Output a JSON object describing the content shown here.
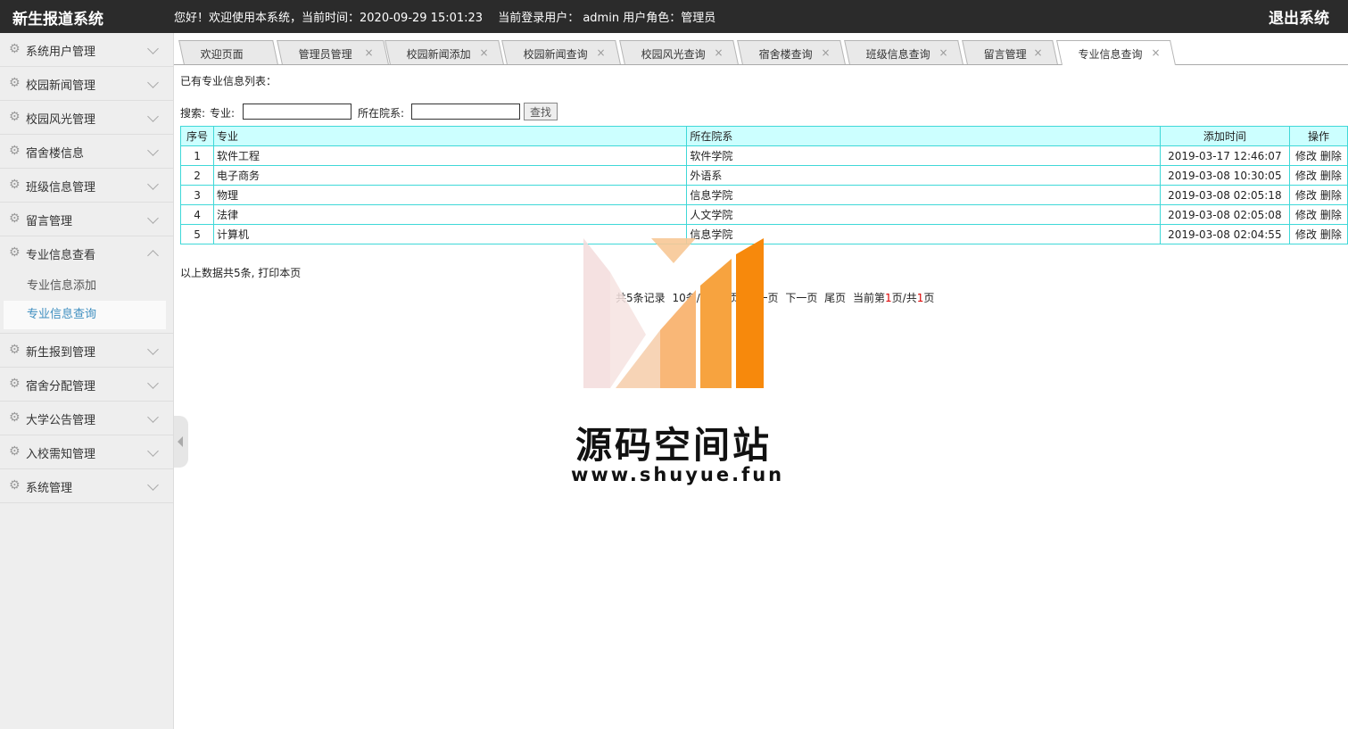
{
  "header": {
    "app_title": "新生报道系统",
    "greeting": "您好！欢迎使用本系统，当前时间：2020-09-29 15:01:23　 当前登录用户： admin  用户角色：管理员",
    "logout_label": "退出系统"
  },
  "sidebar": {
    "items": [
      {
        "label": "系统用户管理"
      },
      {
        "label": "校园新闻管理"
      },
      {
        "label": "校园风光管理"
      },
      {
        "label": "宿舍楼信息"
      },
      {
        "label": "班级信息管理"
      },
      {
        "label": "留言管理"
      },
      {
        "label": "专业信息查看"
      },
      {
        "label": "新生报到管理"
      },
      {
        "label": "宿舍分配管理"
      },
      {
        "label": "大学公告管理"
      },
      {
        "label": "入校需知管理"
      },
      {
        "label": "系统管理"
      }
    ],
    "sub_items": [
      {
        "label": "专业信息添加"
      },
      {
        "label": "专业信息查询"
      }
    ]
  },
  "tabs": [
    {
      "label": "欢迎页面"
    },
    {
      "label": "管理员管理"
    },
    {
      "label": "校园新闻添加"
    },
    {
      "label": "校园新闻查询"
    },
    {
      "label": "校园风光查询"
    },
    {
      "label": "宿舍楼查询"
    },
    {
      "label": "班级信息查询"
    },
    {
      "label": "留言管理"
    },
    {
      "label": "专业信息查询"
    }
  ],
  "tab_close_glyph": "×",
  "main": {
    "caption": "已有专业信息列表：",
    "search": {
      "prefix": "搜索:",
      "major_label": "专业:",
      "major_value": "",
      "dept_label": "所在院系:",
      "dept_value": "",
      "button": "查找"
    },
    "table": {
      "headers": [
        "序号",
        "专业",
        "所在院系",
        "添加时间",
        "操作"
      ],
      "rows": [
        {
          "idx": "1",
          "major": "软件工程",
          "dept": "软件学院",
          "time": "2019-03-17 12:46:07"
        },
        {
          "idx": "2",
          "major": "电子商务",
          "dept": "外语系",
          "time": "2019-03-08 10:30:05"
        },
        {
          "idx": "3",
          "major": "物理",
          "dept": "信息学院",
          "time": "2019-03-08 02:05:18"
        },
        {
          "idx": "4",
          "major": "法律",
          "dept": "人文学院",
          "time": "2019-03-08 02:05:08"
        },
        {
          "idx": "5",
          "major": "计算机",
          "dept": "信息学院",
          "time": "2019-03-08 02:04:55"
        }
      ],
      "edit_label": "修改",
      "delete_label": "删除"
    },
    "summary": "以上数据共5条, 打印本页",
    "pager": {
      "total": "共5条记录",
      "per_page": "10条/页",
      "first": "首页",
      "prev": "上一页",
      "next": "下一页",
      "last": "尾页",
      "current_prefix": "当前第",
      "current_page": "1",
      "mid": "页/共",
      "total_pages": "1",
      "suffix": "页"
    }
  },
  "watermark": {
    "title": "源码空间站",
    "url": "www.shuyue.fun"
  },
  "colors": {
    "header_bg": "#2b2b2b",
    "sidebar_bg": "#eeeeee",
    "active_link": "#3f8fc0",
    "table_border": "#3fd8d8",
    "table_header_bg": "#ccffff",
    "watermark_orange": "#f7890c"
  }
}
